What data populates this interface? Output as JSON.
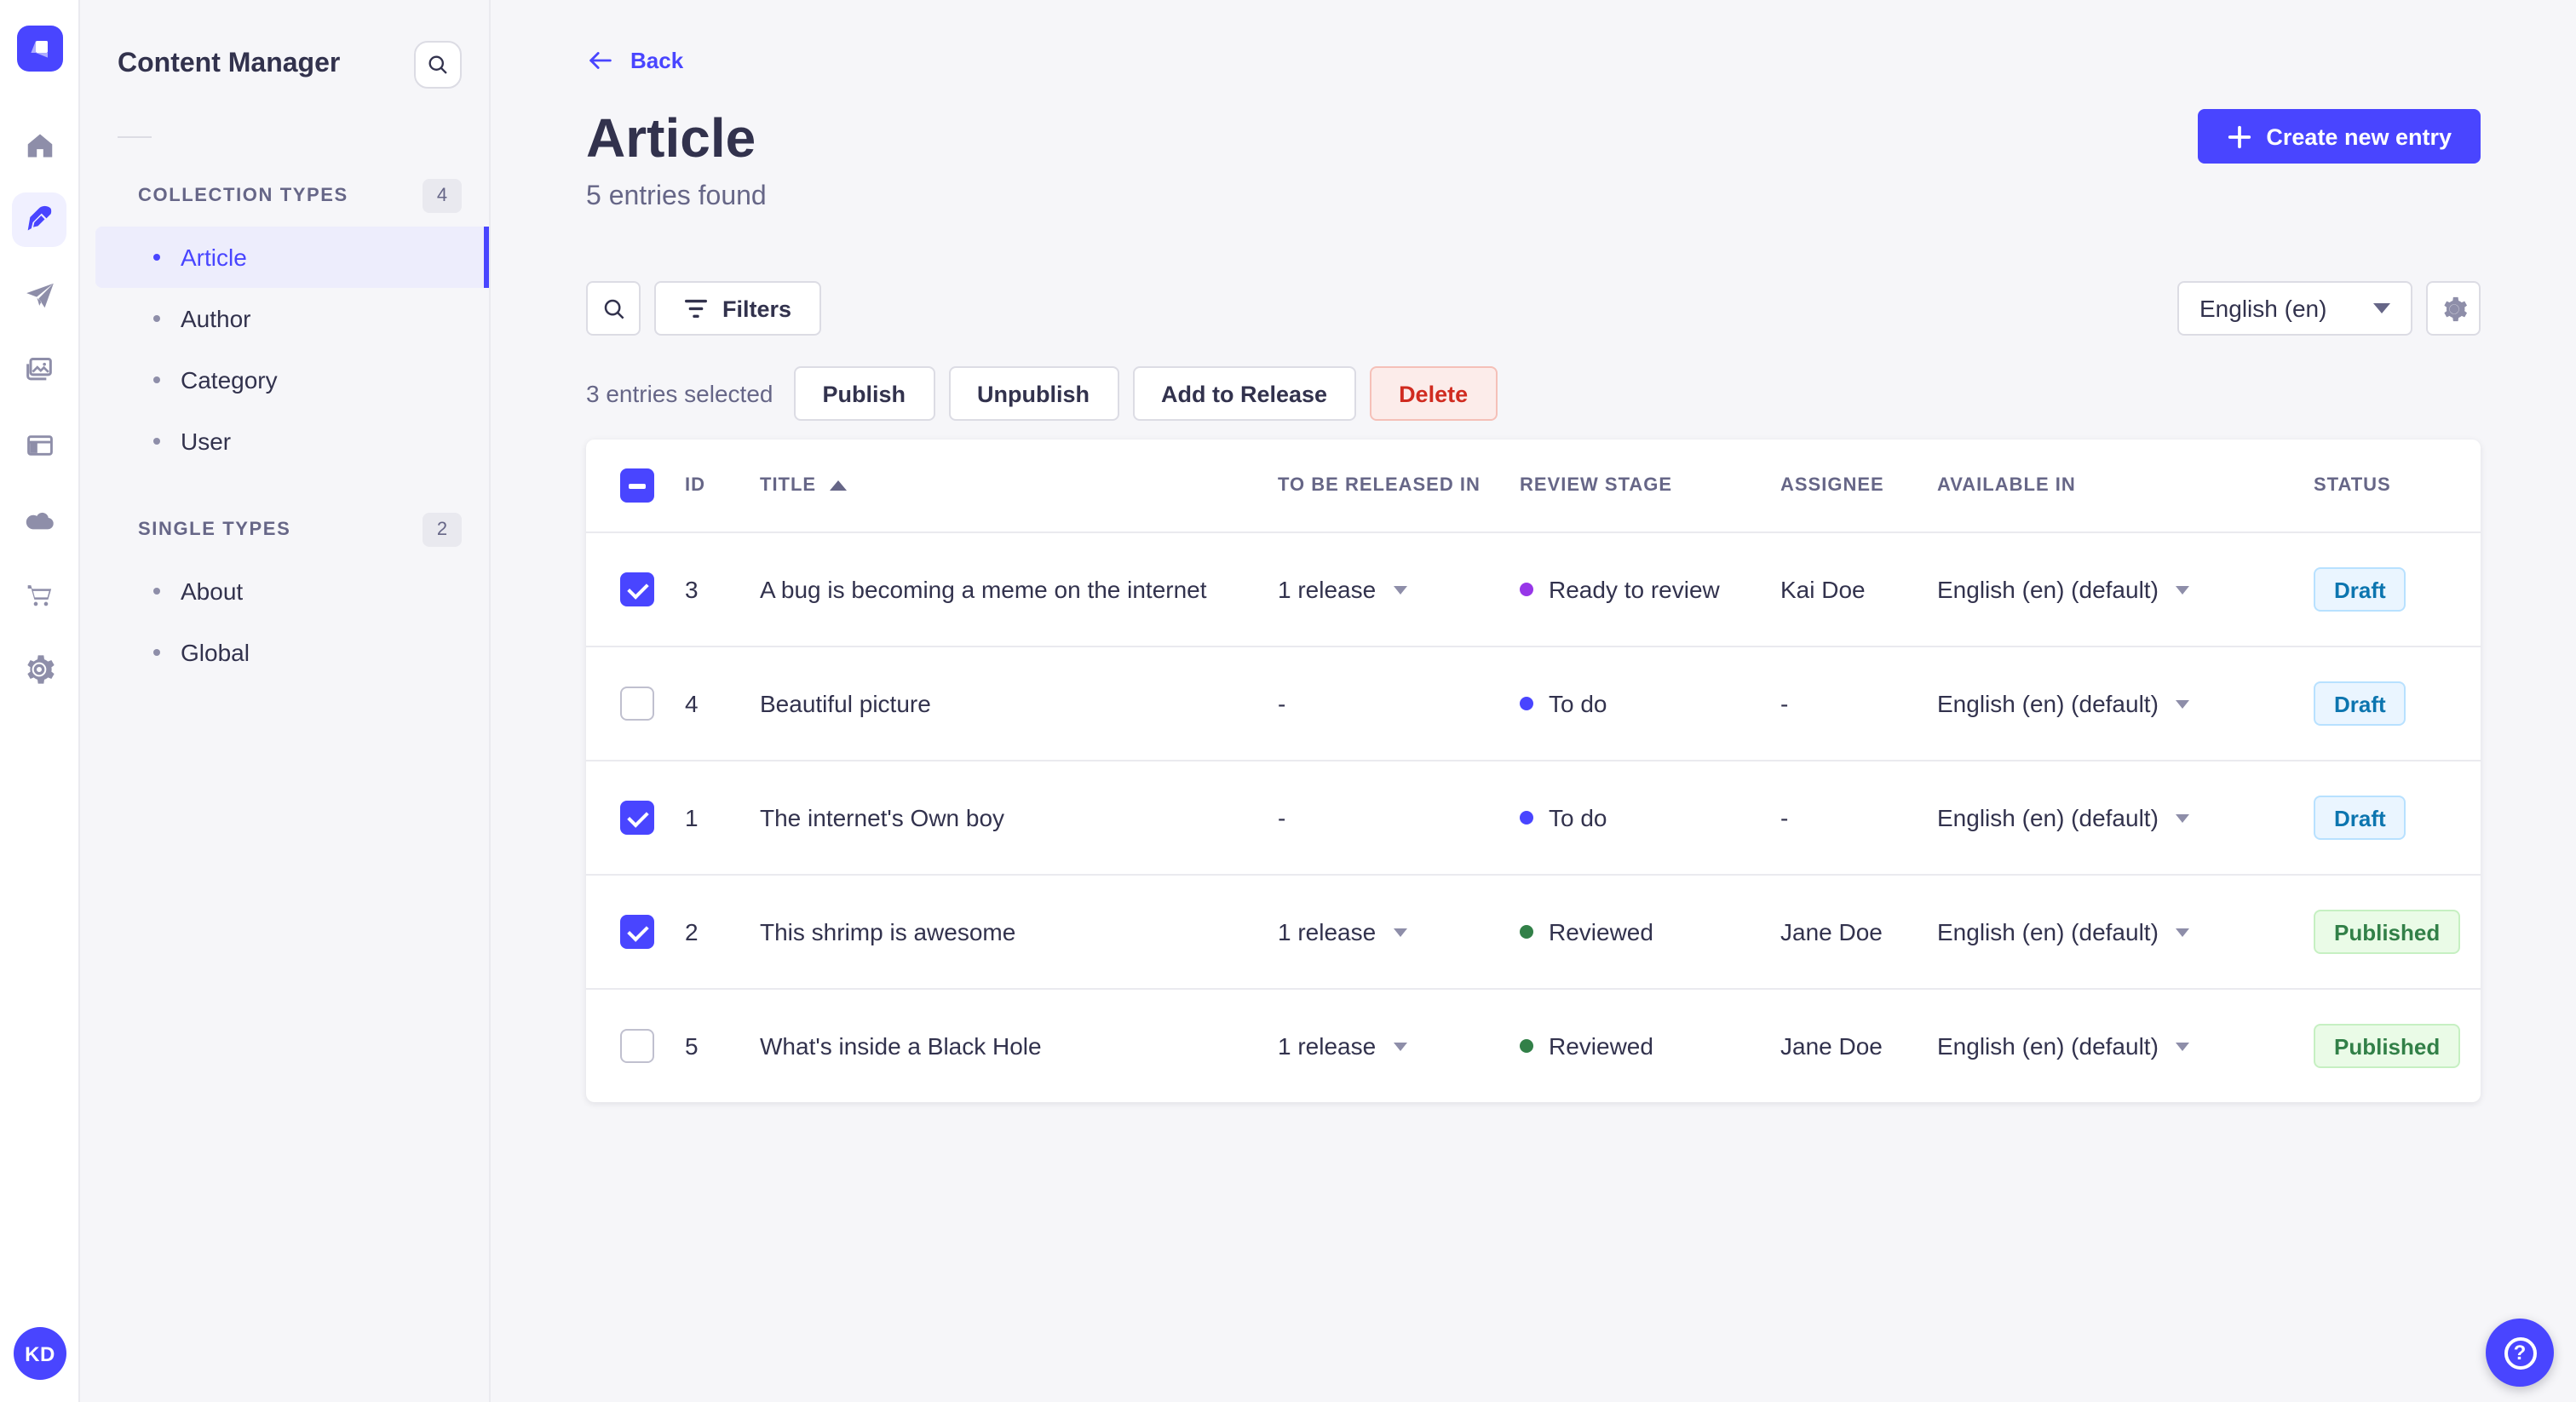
{
  "app": {
    "avatar_initials": "KD"
  },
  "colors": {
    "primary": "#4945ff",
    "danger": "#d02b20",
    "stage_ready_to_review": "#9736e8",
    "stage_to_do": "#4945ff",
    "stage_reviewed": "#328048",
    "status_draft": "#0c75af",
    "status_published": "#328048"
  },
  "subnav": {
    "title": "Content Manager",
    "sections": [
      {
        "label": "COLLECTION TYPES",
        "badge": "4",
        "items": [
          {
            "label": "Article",
            "active": true
          },
          {
            "label": "Author",
            "active": false
          },
          {
            "label": "Category",
            "active": false
          },
          {
            "label": "User",
            "active": false
          }
        ]
      },
      {
        "label": "SINGLE TYPES",
        "badge": "2",
        "items": [
          {
            "label": "About",
            "active": false
          },
          {
            "label": "Global",
            "active": false
          }
        ]
      }
    ]
  },
  "header": {
    "back_label": "Back",
    "title": "Article",
    "subtitle": "5 entries found",
    "create_button_label": "Create new entry"
  },
  "toolbar": {
    "filters_label": "Filters",
    "locale_value": "English (en)"
  },
  "selection": {
    "summary": "3 entries selected",
    "actions": [
      {
        "label": "Publish",
        "variant": "default"
      },
      {
        "label": "Unpublish",
        "variant": "default"
      },
      {
        "label": "Add to Release",
        "variant": "default"
      },
      {
        "label": "Delete",
        "variant": "danger"
      }
    ]
  },
  "table": {
    "header_checkbox_state": "indeterminate",
    "columns": [
      "ID",
      "TITLE",
      "TO BE RELEASED IN",
      "REVIEW STAGE",
      "ASSIGNEE",
      "AVAILABLE IN",
      "STATUS"
    ],
    "sorted_column": "TITLE",
    "sort_direction": "asc",
    "rows": [
      {
        "checked": true,
        "id": "3",
        "title": "A bug is becoming a meme on the internet",
        "release": "1 release",
        "release_menu": true,
        "stage": {
          "label": "Ready to review",
          "color": "#9736e8"
        },
        "assignee": "Kai Doe",
        "locale": "English (en) (default)",
        "status": {
          "label": "Draft",
          "variant": "draft"
        }
      },
      {
        "checked": false,
        "id": "4",
        "title": "Beautiful picture",
        "release": "-",
        "release_menu": false,
        "stage": {
          "label": "To do",
          "color": "#4945ff"
        },
        "assignee": "-",
        "locale": "English (en) (default)",
        "status": {
          "label": "Draft",
          "variant": "draft"
        }
      },
      {
        "checked": true,
        "id": "1",
        "title": "The internet's Own boy",
        "release": "-",
        "release_menu": false,
        "stage": {
          "label": "To do",
          "color": "#4945ff"
        },
        "assignee": "-",
        "locale": "English (en) (default)",
        "status": {
          "label": "Draft",
          "variant": "draft"
        }
      },
      {
        "checked": true,
        "id": "2",
        "title": "This shrimp is awesome",
        "release": "1 release",
        "release_menu": true,
        "stage": {
          "label": "Reviewed",
          "color": "#328048"
        },
        "assignee": "Jane Doe",
        "locale": "English (en) (default)",
        "status": {
          "label": "Published",
          "variant": "published"
        }
      },
      {
        "checked": false,
        "id": "5",
        "title": "What's inside a Black Hole",
        "release": "1 release",
        "release_menu": true,
        "stage": {
          "label": "Reviewed",
          "color": "#328048"
        },
        "assignee": "Jane Doe",
        "locale": "English (en) (default)",
        "status": {
          "label": "Published",
          "variant": "published"
        }
      }
    ]
  }
}
